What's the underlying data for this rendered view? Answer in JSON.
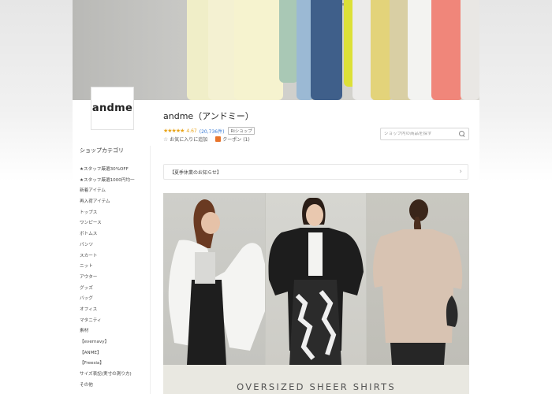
{
  "shop": {
    "logo_text": "andme",
    "title": "andme（アンドミー）",
    "stars": "★★★★★",
    "score": "4.67",
    "review_count": "(20,736件)",
    "badge": "Riショップ",
    "favorite_label": "お気に入りに追加",
    "coupon_label": "クーポン (1)"
  },
  "search": {
    "placeholder": "ショップ内の商品を探す"
  },
  "sidebar": {
    "title": "ショップカテゴリ",
    "items": [
      "★スタッフ厳選30%OFF",
      "★スタッフ厳選1000円均一",
      "新着アイテム",
      "再入荷アイテム",
      "トップス",
      "ワンピース",
      "ボトムス",
      "パンツ",
      "スカート",
      "ニット",
      "アウター",
      "グッズ",
      "バッグ",
      "オフィス",
      "マタニティ",
      "素材",
      "【evernavy】",
      "【ANME】",
      "【Freesia】",
      "サイズ表記(実寸の測り方)",
      "その他"
    ]
  },
  "notice": {
    "label": "【夏季休業のお知らせ】"
  },
  "feature": {
    "caption": "OVERSIZED SHEER SHIRTS"
  },
  "colors": {
    "accent_star": "#e8a317",
    "link_blue": "#3a7bd5",
    "coupon_orange": "#e8742b"
  }
}
